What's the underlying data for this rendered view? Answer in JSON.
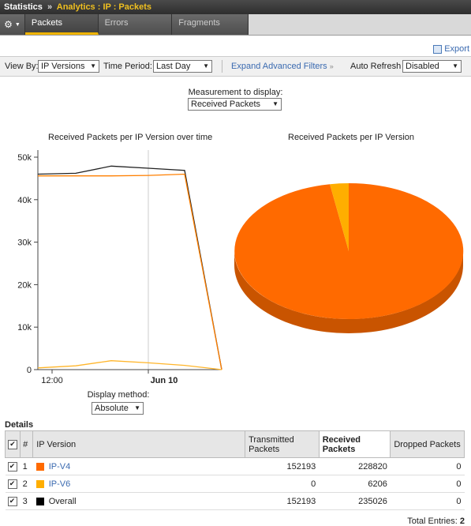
{
  "breadcrumb": {
    "root": "Statistics",
    "separator": "»",
    "trail": "Analytics : IP : Packets"
  },
  "tabs": [
    {
      "label": "Packets"
    },
    {
      "label": "Errors"
    },
    {
      "label": "Fragments"
    }
  ],
  "export_label": "Export",
  "filters": {
    "view_by_label": "View By:",
    "view_by_value": "IP Versions",
    "time_period_label": "Time Period:",
    "time_period_value": "Last Day",
    "expand_label": "Expand Advanced Filters",
    "auto_refresh_label": "Auto Refresh",
    "auto_refresh_value": "Disabled"
  },
  "measurement": {
    "label": "Measurement to display:",
    "value": "Received Packets"
  },
  "line_chart": {
    "title": "Received Packets per IP Version over time",
    "y_ticks": [
      "50k",
      "40k",
      "30k",
      "20k",
      "10k",
      "0"
    ],
    "x_ticks": [
      "12:00",
      "Jun 10"
    ],
    "display_method_label": "Display method:",
    "display_method_value": "Absolute"
  },
  "pie_chart": {
    "title": "Received Packets per IP Version"
  },
  "chart_data": [
    {
      "type": "line",
      "title": "Received Packets per IP Version over time",
      "x": [
        "t0",
        "t1",
        "t2",
        "t3",
        "t4",
        "t5"
      ],
      "ylim": [
        0,
        50000
      ],
      "series": [
        {
          "color": "#222222",
          "values": [
            46000,
            46200,
            47900,
            47400,
            46900,
            0
          ]
        },
        {
          "color": "#ff7f00",
          "values": [
            45600,
            45600,
            45600,
            45700,
            46000,
            0
          ]
        },
        {
          "color": "#ffb52a",
          "values": [
            400,
            900,
            2100,
            1600,
            1000,
            0
          ]
        }
      ]
    },
    {
      "type": "pie",
      "title": "Received Packets per IP Version",
      "labels": [
        "IP-V4",
        "IP-V6"
      ],
      "values": [
        228820,
        6206
      ],
      "colors": [
        "#ff6a00",
        "#ffae00"
      ]
    }
  ],
  "details": {
    "label": "Details",
    "headers": {
      "num": "#",
      "ip": "IP Version",
      "tx": "Transmitted Packets",
      "rx": "Received Packets",
      "dropped": "Dropped Packets"
    },
    "rows": [
      {
        "num": "1",
        "name": "IP-V4",
        "color": "#ff6a00",
        "tx": "152193",
        "rx": "228820",
        "dropped": "0"
      },
      {
        "num": "2",
        "name": "IP-V6",
        "color": "#ffae00",
        "tx": "0",
        "rx": "6206",
        "dropped": "0"
      },
      {
        "num": "3",
        "name": "Overall",
        "color": "#000000",
        "tx": "152193",
        "rx": "235026",
        "dropped": "0"
      }
    ],
    "total_label": "Total Entries:",
    "total_value": "2"
  }
}
